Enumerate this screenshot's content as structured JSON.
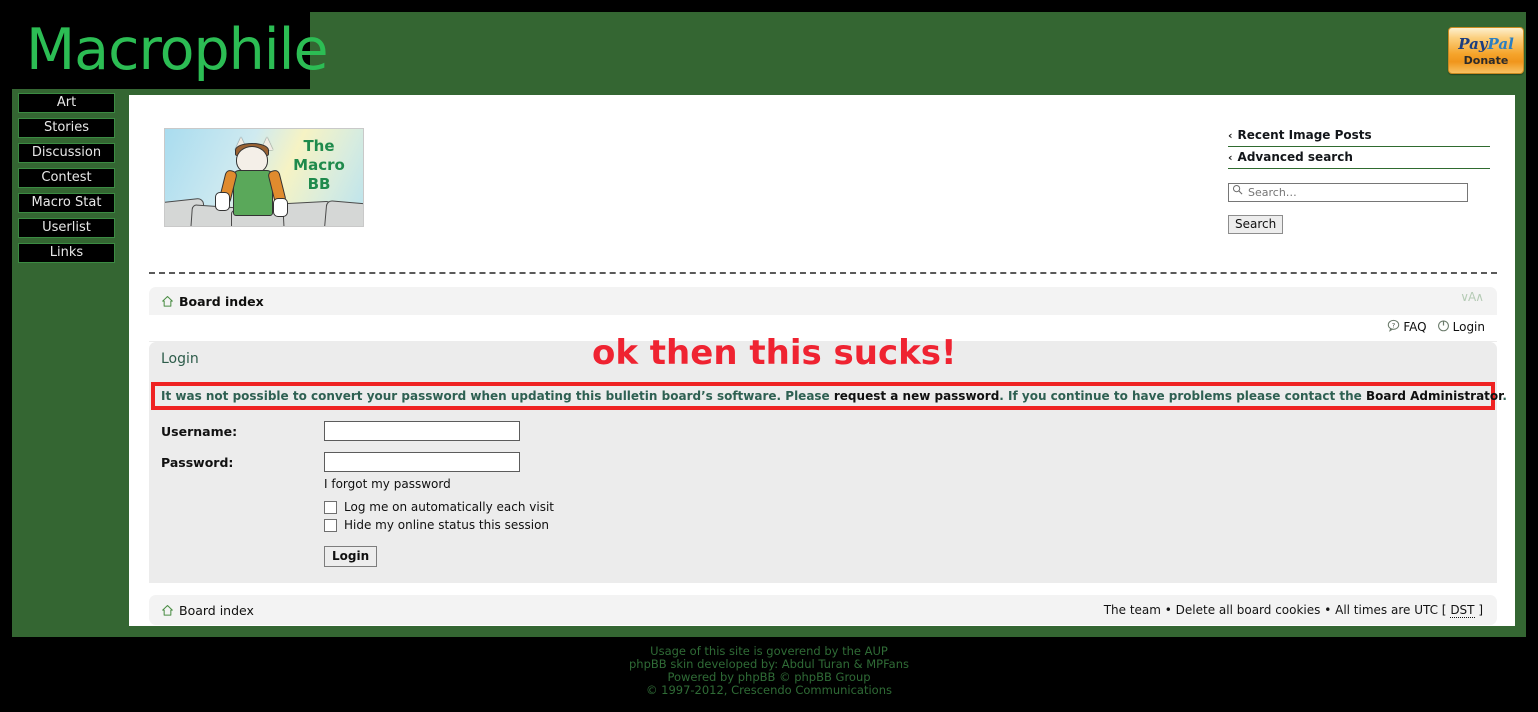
{
  "site": {
    "logo_text": "Macrophile",
    "donate": {
      "word_pay": "Pay",
      "word_pal": "Pal",
      "label": "Donate"
    },
    "accent_green": "#2cbd54",
    "background_green": "#346632",
    "error_red": "#ef2222"
  },
  "left_nav": {
    "items": [
      {
        "label": "Art"
      },
      {
        "label": "Stories"
      },
      {
        "label": "Discussion"
      },
      {
        "label": "Contest"
      },
      {
        "label": "Macro Stat"
      },
      {
        "label": "Userlist"
      },
      {
        "label": "Links"
      }
    ]
  },
  "banner": {
    "title_line1": "The",
    "title_line2": "Macro",
    "title_line3": "BB"
  },
  "search_panel": {
    "links": [
      {
        "label": "Recent Image Posts",
        "chevron": "‹"
      },
      {
        "label": "Advanced search",
        "chevron": "‹"
      }
    ],
    "input_value": "",
    "input_placeholder": "Search…",
    "button_label": "Search"
  },
  "forum": {
    "breadcrumb_top": "Board index",
    "breadcrumb_bottom": "Board index",
    "fontsize_control": "∨A∧",
    "quicklinks": [
      {
        "label": "FAQ",
        "icon": "faq-icon"
      },
      {
        "label": "Login",
        "icon": "power-icon"
      }
    ],
    "panel_title": "Login",
    "error": {
      "part1": "It was not possible to convert your password when updating this bulletin board’s software. Please ",
      "link1": "request a new password",
      "part2": ". If you continue to have problems please contact the ",
      "link2": "Board Administrator",
      "part3": "."
    },
    "form": {
      "username_label": "Username:",
      "username_value": "",
      "password_label": "Password:",
      "password_value": "",
      "forgot_label": "I forgot my password",
      "checkbox_autologin": "Log me on automatically each visit",
      "checkbox_hide": "Hide my online status this session",
      "submit_label": "Login"
    },
    "footer_links": "The team • Delete all board cookies • All times are UTC [ ",
    "footer_dst": "DST",
    "footer_tail": " ]"
  },
  "annotation": {
    "text": "ok then this sucks!"
  },
  "page_footer": {
    "line1": "Usage of this site is goverend by the AUP",
    "line2": "phpBB skin developed by: Abdul Turan & MPFans",
    "line3": "Powered by phpBB © phpBB Group",
    "line4": "© 1997-2012, Crescendo Communications"
  }
}
